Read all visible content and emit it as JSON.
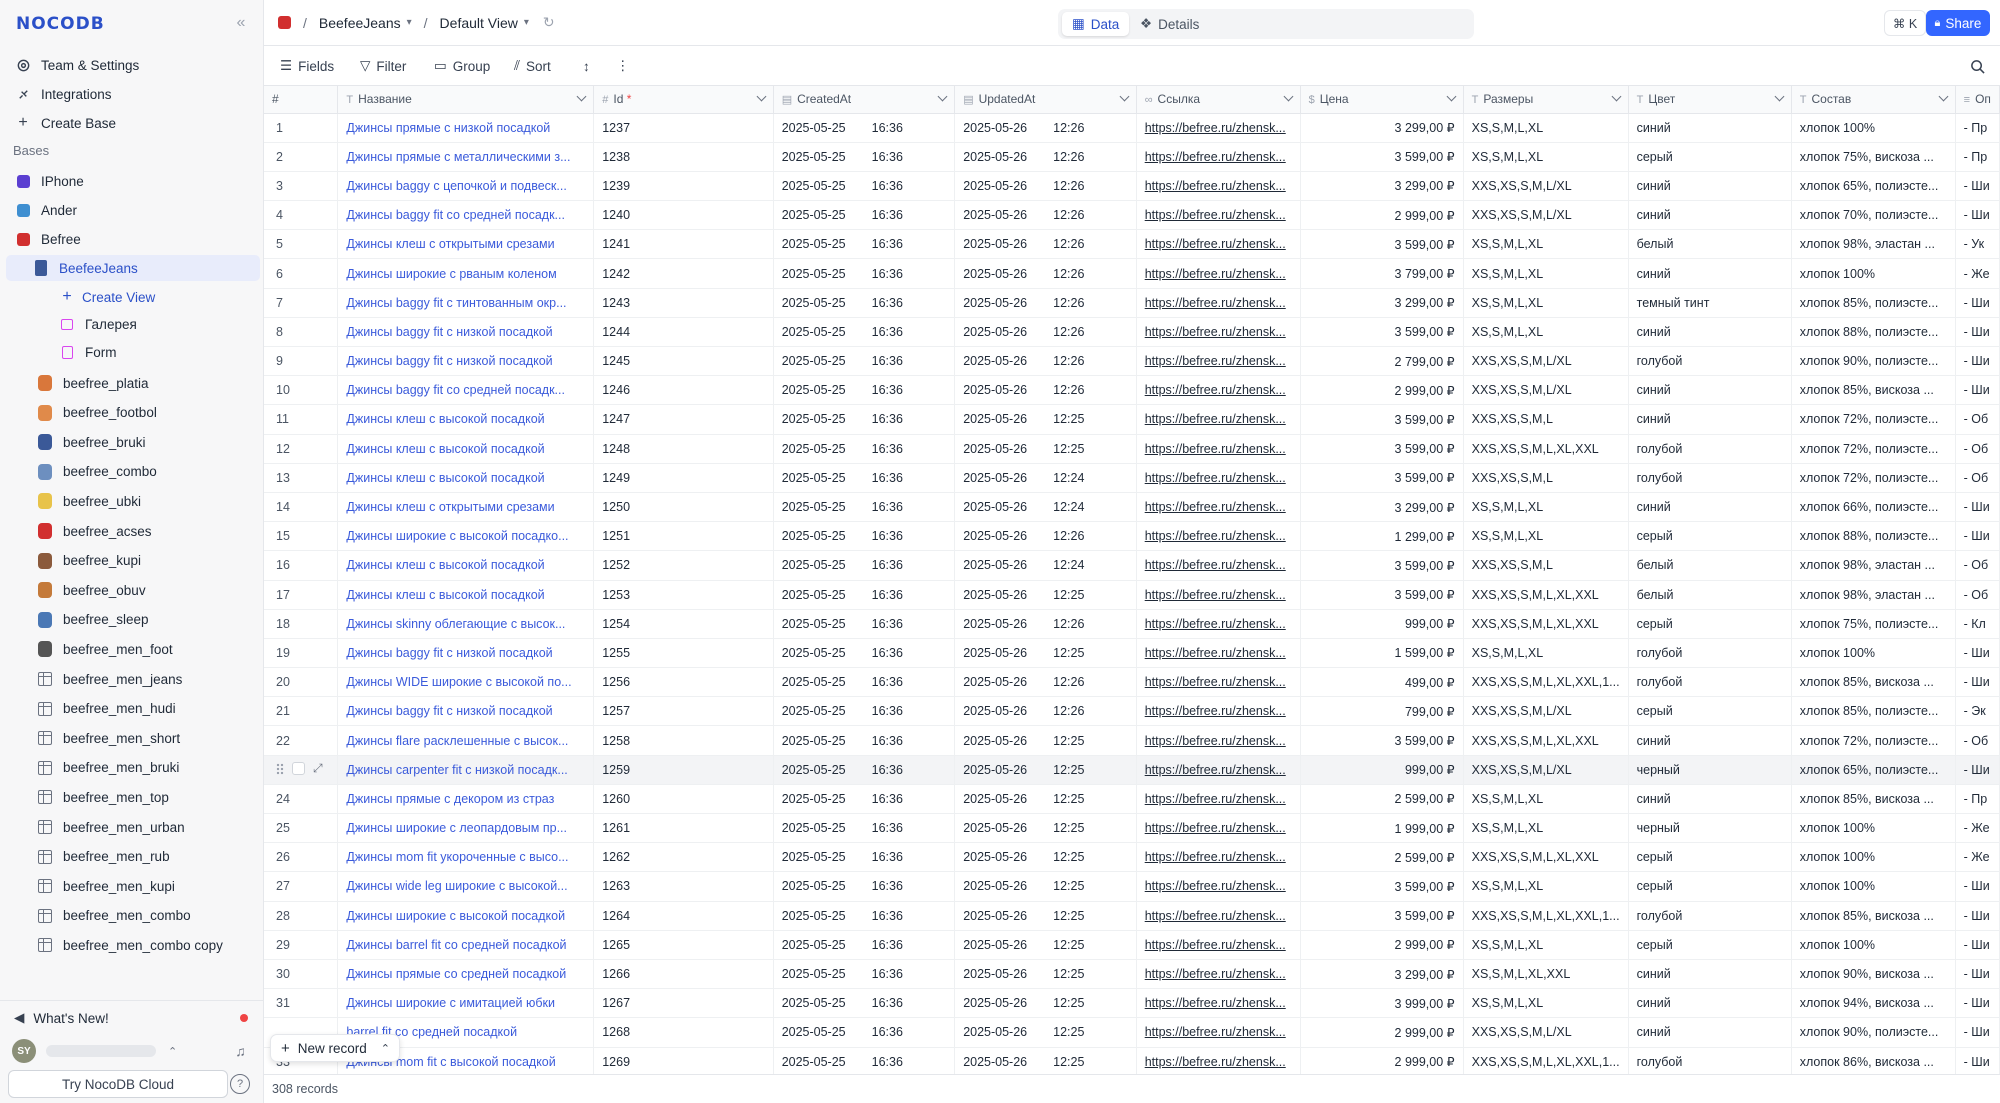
{
  "app": {
    "logo": "NOCODB"
  },
  "sidebar": {
    "team_settings": "Team & Settings",
    "integrations": "Integrations",
    "create_base": "Create Base",
    "bases_label": "Bases",
    "bases": [
      {
        "label": "IPhone",
        "color": "#5b3fd1"
      },
      {
        "label": "Ander",
        "color": "#3f8fd1"
      },
      {
        "label": "Befree",
        "color": "#d12f2f"
      }
    ],
    "active_table": "BeefeeJeans",
    "create_view": "Create View",
    "views": [
      "Галерея",
      "Form"
    ],
    "tables": [
      "beefree_platia",
      "beefree_footbol",
      "beefree_bruki",
      "beefree_combo",
      "beefree_ubki",
      "beefree_acses",
      "beefree_kupi",
      "beefree_obuv",
      "beefree_sleep",
      "beefree_men_foot",
      "beefree_men_jeans",
      "beefree_men_hudi",
      "beefree_men_short",
      "beefree_men_bruki",
      "beefree_men_top",
      "beefree_men_urban",
      "beefree_men_rub",
      "beefree_men_kupi",
      "beefree_men_combo",
      "beefree_men_combo copy"
    ],
    "whats_new": "What's New!",
    "avatar_initials": "SY",
    "try_cloud": "Try NocoDB Cloud"
  },
  "topbar": {
    "base_name": "BeefeeJeans",
    "view_name": "Default View",
    "tab_data": "Data",
    "tab_details": "Details",
    "shortcut": "⌘ K",
    "share": "Share"
  },
  "toolbar": {
    "fields": "Fields",
    "filter": "Filter",
    "group": "Group",
    "sort": "Sort"
  },
  "grid": {
    "columns": [
      "#",
      "Название",
      "Id",
      "CreatedAt",
      "UpdatedAt",
      "Ссылка",
      "Цена",
      "Размеры",
      "Цвет",
      "Состав",
      "Оп"
    ],
    "rows": [
      [
        "1",
        "Джинсы прямые с низкой посадкой",
        "1237",
        "2025-05-25",
        "16:36",
        "2025-05-26",
        "12:26",
        "https://befree.ru/zhensk...",
        "3 299,00 ₽",
        "XS,S,M,L,XL",
        "синий",
        "хлопок 100%",
        "- Пр"
      ],
      [
        "2",
        "Джинсы прямые с металлическими з...",
        "1238",
        "2025-05-25",
        "16:36",
        "2025-05-26",
        "12:26",
        "https://befree.ru/zhensk...",
        "3 599,00 ₽",
        "XS,S,M,L,XL",
        "серый",
        "хлопок 75%, вискоза ...",
        "- Пр"
      ],
      [
        "3",
        "Джинсы baggy с цепочкой и подвеск...",
        "1239",
        "2025-05-25",
        "16:36",
        "2025-05-26",
        "12:26",
        "https://befree.ru/zhensk...",
        "3 299,00 ₽",
        "XXS,XS,S,M,L/XL",
        "синий",
        "хлопок 65%, полиэсте...",
        "- Ши"
      ],
      [
        "4",
        "Джинсы baggy fit со средней посадк...",
        "1240",
        "2025-05-25",
        "16:36",
        "2025-05-26",
        "12:26",
        "https://befree.ru/zhensk...",
        "2 999,00 ₽",
        "XXS,XS,S,M,L/XL",
        "синий",
        "хлопок 70%, полиэсте...",
        "- Ши"
      ],
      [
        "5",
        "Джинсы клеш с открытыми срезами",
        "1241",
        "2025-05-25",
        "16:36",
        "2025-05-26",
        "12:26",
        "https://befree.ru/zhensk...",
        "3 599,00 ₽",
        "XS,S,M,L,XL",
        "белый",
        "хлопок 98%, эластан ...",
        "- Ук"
      ],
      [
        "6",
        "Джинсы широкие с рваным коленом",
        "1242",
        "2025-05-25",
        "16:36",
        "2025-05-26",
        "12:26",
        "https://befree.ru/zhensk...",
        "3 799,00 ₽",
        "XS,S,M,L,XL",
        "синий",
        "хлопок 100%",
        "- Же"
      ],
      [
        "7",
        "Джинсы baggy fit с тинтованным окр...",
        "1243",
        "2025-05-25",
        "16:36",
        "2025-05-26",
        "12:26",
        "https://befree.ru/zhensk...",
        "3 299,00 ₽",
        "XS,S,M,L,XL",
        "темный тинт",
        "хлопок 85%, полиэсте...",
        "- Ши"
      ],
      [
        "8",
        "Джинсы baggy fit с низкой посадкой",
        "1244",
        "2025-05-25",
        "16:36",
        "2025-05-26",
        "12:26",
        "https://befree.ru/zhensk...",
        "3 599,00 ₽",
        "XS,S,M,L,XL",
        "синий",
        "хлопок 88%, полиэсте...",
        "- Ши"
      ],
      [
        "9",
        "Джинсы baggy fit с низкой посадкой",
        "1245",
        "2025-05-25",
        "16:36",
        "2025-05-26",
        "12:26",
        "https://befree.ru/zhensk...",
        "2 799,00 ₽",
        "XXS,XS,S,M,L/XL",
        "голубой",
        "хлопок 90%, полиэсте...",
        "- Ши"
      ],
      [
        "10",
        "Джинсы baggy fit со средней посадк...",
        "1246",
        "2025-05-25",
        "16:36",
        "2025-05-26",
        "12:26",
        "https://befree.ru/zhensk...",
        "2 999,00 ₽",
        "XXS,XS,S,M,L/XL",
        "синий",
        "хлопок 85%, вискоза ...",
        "- Ши"
      ],
      [
        "11",
        "Джинсы клеш с высокой посадкой",
        "1247",
        "2025-05-25",
        "16:36",
        "2025-05-26",
        "12:25",
        "https://befree.ru/zhensk...",
        "3 599,00 ₽",
        "XXS,XS,S,M,L",
        "синий",
        "хлопок 72%, полиэсте...",
        "- Об"
      ],
      [
        "12",
        "Джинсы клеш с высокой посадкой",
        "1248",
        "2025-05-25",
        "16:36",
        "2025-05-26",
        "12:25",
        "https://befree.ru/zhensk...",
        "3 599,00 ₽",
        "XXS,XS,S,M,L,XL,XXL",
        "голубой",
        "хлопок 72%, полиэсте...",
        "- Об"
      ],
      [
        "13",
        "Джинсы клеш с высокой посадкой",
        "1249",
        "2025-05-25",
        "16:36",
        "2025-05-26",
        "12:24",
        "https://befree.ru/zhensk...",
        "3 599,00 ₽",
        "XXS,XS,S,M,L",
        "голубой",
        "хлопок 72%, полиэсте...",
        "- Об"
      ],
      [
        "14",
        "Джинсы клеш с открытыми срезами",
        "1250",
        "2025-05-25",
        "16:36",
        "2025-05-26",
        "12:24",
        "https://befree.ru/zhensk...",
        "3 299,00 ₽",
        "XS,S,M,L,XL",
        "синий",
        "хлопок 66%, полиэсте...",
        "- Ши"
      ],
      [
        "15",
        "Джинсы широкие с высокой посадко...",
        "1251",
        "2025-05-25",
        "16:36",
        "2025-05-26",
        "12:26",
        "https://befree.ru/zhensk...",
        "1 299,00 ₽",
        "XS,S,M,L,XL",
        "серый",
        "хлопок 88%, полиэсте...",
        "- Ши"
      ],
      [
        "16",
        "Джинсы клеш с высокой посадкой",
        "1252",
        "2025-05-25",
        "16:36",
        "2025-05-26",
        "12:24",
        "https://befree.ru/zhensk...",
        "3 599,00 ₽",
        "XXS,XS,S,M,L",
        "белый",
        "хлопок 98%, эластан ...",
        "- Об"
      ],
      [
        "17",
        "Джинсы клеш с высокой посадкой",
        "1253",
        "2025-05-25",
        "16:36",
        "2025-05-26",
        "12:25",
        "https://befree.ru/zhensk...",
        "3 599,00 ₽",
        "XXS,XS,S,M,L,XL,XXL",
        "белый",
        "хлопок 98%, эластан ...",
        "- Об"
      ],
      [
        "18",
        "Джинсы skinny облегающие с высок...",
        "1254",
        "2025-05-25",
        "16:36",
        "2025-05-26",
        "12:26",
        "https://befree.ru/zhensk...",
        "999,00 ₽",
        "XXS,XS,S,M,L,XL,XXL",
        "серый",
        "хлопок 75%, полиэсте...",
        "- Кл"
      ],
      [
        "19",
        "Джинсы baggy fit с низкой посадкой",
        "1255",
        "2025-05-25",
        "16:36",
        "2025-05-26",
        "12:25",
        "https://befree.ru/zhensk...",
        "1 599,00 ₽",
        "XS,S,M,L,XL",
        "голубой",
        "хлопок 100%",
        "- Ши"
      ],
      [
        "20",
        "Джинсы WIDE широкие с высокой по...",
        "1256",
        "2025-05-25",
        "16:36",
        "2025-05-26",
        "12:26",
        "https://befree.ru/zhensk...",
        "499,00 ₽",
        "XXS,XS,S,M,L,XL,XXL,1...",
        "голубой",
        "хлопок 85%, вискоза ...",
        "- Ши"
      ],
      [
        "21",
        "Джинсы baggy fit с низкой посадкой",
        "1257",
        "2025-05-25",
        "16:36",
        "2025-05-26",
        "12:26",
        "https://befree.ru/zhensk...",
        "799,00 ₽",
        "XXS,XS,S,M,L/XL",
        "серый",
        "хлопок 85%, полиэсте...",
        "- Эк"
      ],
      [
        "22",
        "Джинсы flare расклешенные с высок...",
        "1258",
        "2025-05-25",
        "16:36",
        "2025-05-26",
        "12:25",
        "https://befree.ru/zhensk...",
        "3 599,00 ₽",
        "XXS,XS,S,M,L,XL,XXL",
        "синий",
        "хлопок 72%, полиэсте...",
        "- Об"
      ],
      [
        "",
        "Джинсы carpenter fit с низкой посадк...",
        "1259",
        "2025-05-25",
        "16:36",
        "2025-05-26",
        "12:25",
        "https://befree.ru/zhensk...",
        "999,00 ₽",
        "XXS,XS,S,M,L/XL",
        "черный",
        "хлопок 65%, полиэсте...",
        "- Ши"
      ],
      [
        "24",
        "Джинсы прямые с декором из страз",
        "1260",
        "2025-05-25",
        "16:36",
        "2025-05-26",
        "12:25",
        "https://befree.ru/zhensk...",
        "2 599,00 ₽",
        "XS,S,M,L,XL",
        "синий",
        "хлопок 85%, вискоза ...",
        "- Пр"
      ],
      [
        "25",
        "Джинсы широкие с леопардовым пр...",
        "1261",
        "2025-05-25",
        "16:36",
        "2025-05-26",
        "12:25",
        "https://befree.ru/zhensk...",
        "1 999,00 ₽",
        "XS,S,M,L,XL",
        "черный",
        "хлопок 100%",
        "- Же"
      ],
      [
        "26",
        "Джинсы mom fit укороченные с высо...",
        "1262",
        "2025-05-25",
        "16:36",
        "2025-05-26",
        "12:25",
        "https://befree.ru/zhensk...",
        "2 599,00 ₽",
        "XXS,XS,S,M,L,XL,XXL",
        "серый",
        "хлопок 100%",
        "- Же"
      ],
      [
        "27",
        "Джинсы wide leg широкие с высокой...",
        "1263",
        "2025-05-25",
        "16:36",
        "2025-05-26",
        "12:25",
        "https://befree.ru/zhensk...",
        "3 599,00 ₽",
        "XS,S,M,L,XL",
        "серый",
        "хлопок 100%",
        "- Ши"
      ],
      [
        "28",
        "Джинсы широкие с высокой посадкой",
        "1264",
        "2025-05-25",
        "16:36",
        "2025-05-26",
        "12:25",
        "https://befree.ru/zhensk...",
        "3 599,00 ₽",
        "XXS,XS,S,M,L,XL,XXL,1...",
        "голубой",
        "хлопок 85%, вискоза ...",
        "- Ши"
      ],
      [
        "29",
        "Джинсы barrel fit со средней посадкой",
        "1265",
        "2025-05-25",
        "16:36",
        "2025-05-26",
        "12:25",
        "https://befree.ru/zhensk...",
        "2 999,00 ₽",
        "XS,S,M,L,XL",
        "серый",
        "хлопок 100%",
        "- Ши"
      ],
      [
        "30",
        "Джинсы прямые со средней посадкой",
        "1266",
        "2025-05-25",
        "16:36",
        "2025-05-26",
        "12:25",
        "https://befree.ru/zhensk...",
        "3 299,00 ₽",
        "XS,S,M,L,XL,XXL",
        "синий",
        "хлопок 90%, вискоза ...",
        "- Ши"
      ],
      [
        "31",
        "Джинсы широкие с имитацией юбки",
        "1267",
        "2025-05-25",
        "16:36",
        "2025-05-26",
        "12:25",
        "https://befree.ru/zhensk...",
        "3 999,00 ₽",
        "XS,S,M,L,XL",
        "синий",
        "хлопок 94%, вискоза ...",
        "- Ши"
      ],
      [
        "",
        "barrel fit со средней посадкой",
        "1268",
        "2025-05-25",
        "16:36",
        "2025-05-26",
        "12:25",
        "https://befree.ru/zhensk...",
        "2 999,00 ₽",
        "XXS,XS,S,M,L/XL",
        "синий",
        "хлопок 90%, полиэсте...",
        "- Ши"
      ],
      [
        "33",
        "Джинсы mom fit с высокой посадкой",
        "1269",
        "2025-05-25",
        "16:36",
        "2025-05-26",
        "12:25",
        "https://befree.ru/zhensk...",
        "2 999,00 ₽",
        "XXS,XS,S,M,L,XL,XXL,1...",
        "голубой",
        "хлопок 86%, вискоза ...",
        "- Ши"
      ]
    ],
    "record_count": "308 records",
    "new_record": "New record"
  }
}
